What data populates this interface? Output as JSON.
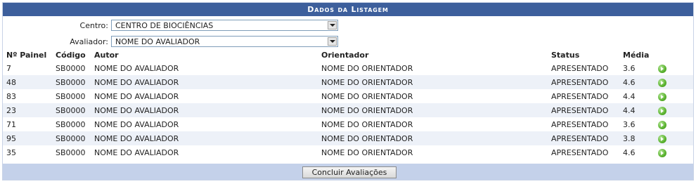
{
  "caption": "Dados da Listagem",
  "filters": {
    "centro": {
      "label": "Centro:",
      "value": "CENTRO DE BIOCIÊNCIAS"
    },
    "avaliador": {
      "label": "Avaliador:",
      "value": "NOME DO AVALIADOR"
    }
  },
  "table": {
    "headers": [
      "Nº Painel",
      "Código",
      "Autor",
      "Orientador",
      "Status",
      "Média"
    ],
    "rows": [
      [
        "7",
        "SB0000",
        "NOME DO AVALIADOR",
        "NOME DO ORIENTADOR",
        "APRESENTADO",
        "3.6"
      ],
      [
        "48",
        "SB0000",
        "NOME DO AVALIADOR",
        "NOME DO ORIENTADOR",
        "APRESENTADO",
        "4.6"
      ],
      [
        "83",
        "SB0000",
        "NOME DO AVALIADOR",
        "NOME DO ORIENTADOR",
        "APRESENTADO",
        "4.4"
      ],
      [
        "23",
        "SB0000",
        "NOME DO AVALIADOR",
        "NOME DO ORIENTADOR",
        "APRESENTADO",
        "4.4"
      ],
      [
        "71",
        "SB0000",
        "NOME DO AVALIADOR",
        "NOME DO ORIENTADOR",
        "APRESENTADO",
        "3.6"
      ],
      [
        "95",
        "SB0000",
        "NOME DO AVALIADOR",
        "NOME DO ORIENTADOR",
        "APRESENTADO",
        "3.8"
      ],
      [
        "35",
        "SB0000",
        "NOME DO AVALIADOR",
        "NOME DO ORIENTADOR",
        "APRESENTADO",
        "4.6"
      ]
    ],
    "row_action_icon": "green-arrow-go-icon"
  },
  "footer": {
    "submit_label": "Concluir Avaliações"
  },
  "colors": {
    "caption_bg": "#3d5f9c",
    "footer_bg": "#c4d1ea",
    "row_alt_bg": "#edf1f8"
  }
}
